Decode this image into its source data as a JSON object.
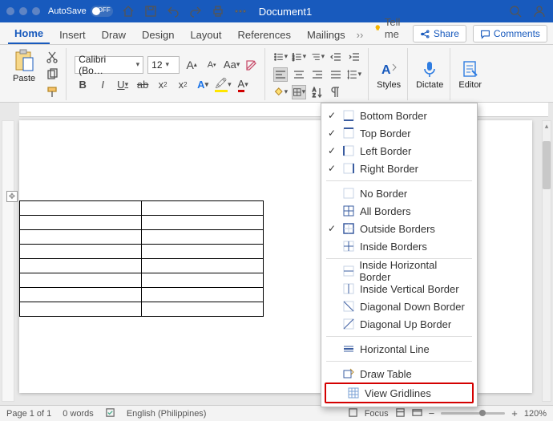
{
  "titlebar": {
    "autosave_label": "AutoSave",
    "switch_text": "OFF",
    "doc_title": "Document1"
  },
  "tabs": {
    "home": "Home",
    "insert": "Insert",
    "draw": "Draw",
    "design": "Design",
    "layout": "Layout",
    "references": "References",
    "mailings": "Mailings",
    "tell_me": "Tell me",
    "share": "Share",
    "comments": "Comments"
  },
  "ribbon": {
    "paste": "Paste",
    "font_name": "Calibri (Bo…",
    "font_size": "12",
    "styles": "Styles",
    "dictate": "Dictate",
    "editor": "Editor"
  },
  "borders_menu": {
    "bottom": "Bottom Border",
    "top": "Top Border",
    "left": "Left Border",
    "right": "Right Border",
    "none": "No Border",
    "all": "All Borders",
    "outside": "Outside Borders",
    "inside": "Inside Borders",
    "inside_h": "Inside Horizontal Border",
    "inside_v": "Inside Vertical Border",
    "diag_down": "Diagonal Down Border",
    "diag_up": "Diagonal Up Border",
    "hline": "Horizontal Line",
    "draw_table": "Draw Table",
    "view_gridlines": "View Gridlines"
  },
  "statusbar": {
    "page": "Page 1 of 1",
    "words": "0 words",
    "language": "English (Philippines)",
    "focus": "Focus",
    "zoom": "120%"
  }
}
